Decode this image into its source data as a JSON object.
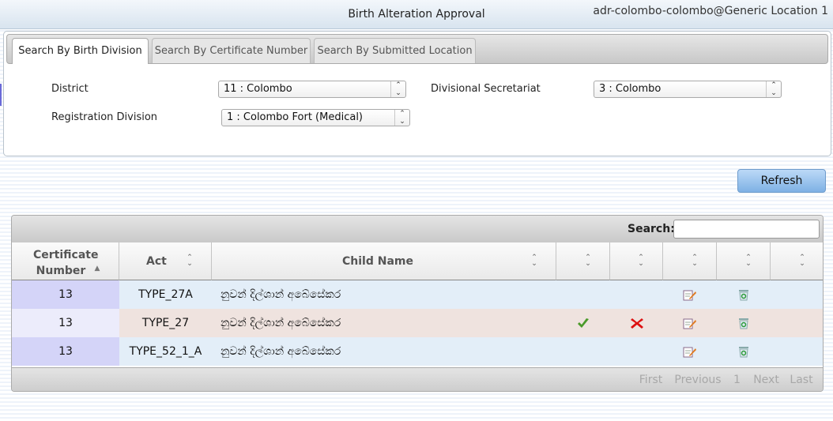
{
  "header": {
    "title": "Birth Alteration Approval",
    "user_location": "adr-colombo-colombo@Generic Location 1"
  },
  "tabs": [
    {
      "label": "Search By Birth Division",
      "active": true
    },
    {
      "label": "Search By Certificate Number",
      "active": false
    },
    {
      "label": "Search By Submitted Location",
      "active": false
    }
  ],
  "form": {
    "district_label": "District",
    "district_value": "11 : Colombo",
    "ds_label": "Divisional Secretariat",
    "ds_value": "3 : Colombo",
    "reg_div_label": "Registration Division",
    "reg_div_value": "1 : Colombo Fort (Medical)"
  },
  "refresh_label": "Refresh",
  "grid": {
    "search_label": "Search:",
    "search_value": "",
    "columns": [
      "Certificate Number",
      "Act",
      "Child Name",
      "",
      "",
      "",
      "",
      ""
    ],
    "rows": [
      {
        "cert": "13",
        "act": "TYPE_27A",
        "name": "නුවන් දිල්ශාන් අබේසේකර",
        "approve": false,
        "reject": false
      },
      {
        "cert": "13",
        "act": "TYPE_27",
        "name": "නුවන් දිල්ශාන් අබේසේකර",
        "approve": true,
        "reject": true
      },
      {
        "cert": "13",
        "act": "TYPE_52_1_A",
        "name": "නුවන් දිල්ශාන් අබේසේකර",
        "approve": false,
        "reject": false
      }
    ],
    "pagination": {
      "first": "First",
      "previous": "Previous",
      "page": "1",
      "next": "Next",
      "last": "Last"
    }
  },
  "colors": {
    "accent_button": "#7eb1e4",
    "row_blue": "#e3eef8",
    "row_pink": "#efe3df",
    "cert_cell": "#d4d4f8",
    "approve": "#4a9a2a",
    "reject": "#dd1111"
  },
  "icons": {
    "approve": "checkmark-icon",
    "reject": "cross-icon",
    "edit": "edit-icon",
    "delete": "recycle-bin-icon",
    "sort": "sort-icon"
  }
}
